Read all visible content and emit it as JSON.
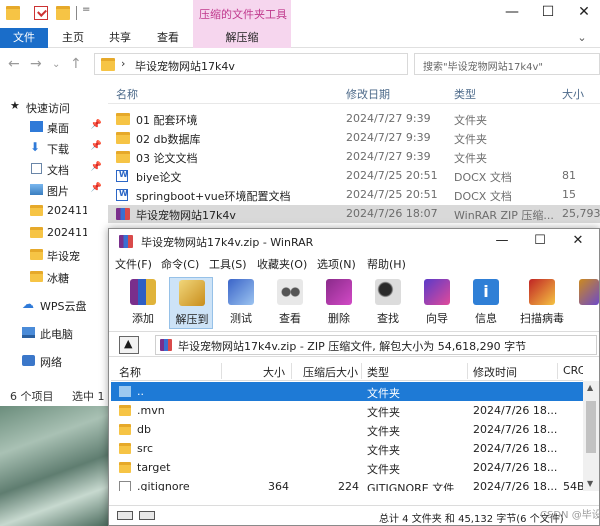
{
  "explorer": {
    "quick_access_suffix": "=",
    "context_tab_header": "压缩的文件夹工具",
    "ribbon_tabs": [
      "文件",
      "主页",
      "共享",
      "查看",
      "解压缩"
    ],
    "address": "毕设宠物网站17k4v",
    "search_placeholder": "搜索\"毕设宠物网站17k4v\"",
    "sidebar": {
      "items": [
        {
          "label": "快速访问",
          "icon": "star-icon",
          "pinned": false
        },
        {
          "label": "桌面",
          "icon": "desktop-icon",
          "pinned": true
        },
        {
          "label": "下载",
          "icon": "download-icon",
          "pinned": true
        },
        {
          "label": "文档",
          "icon": "document-icon",
          "pinned": true
        },
        {
          "label": "图片",
          "icon": "pictures-icon",
          "pinned": true
        },
        {
          "label": "202411",
          "icon": "folder-icon",
          "pinned": false
        },
        {
          "label": "202411",
          "icon": "folder-icon",
          "pinned": false
        },
        {
          "label": "毕设宠",
          "icon": "folder-icon",
          "pinned": false
        },
        {
          "label": "冰糖",
          "icon": "folder-icon",
          "pinned": false
        },
        {
          "label": "WPS云盘",
          "icon": "cloud-icon",
          "pinned": false
        },
        {
          "label": "此电脑",
          "icon": "computer-icon",
          "pinned": false
        },
        {
          "label": "网络",
          "icon": "network-icon",
          "pinned": false
        }
      ]
    },
    "status": {
      "count": "6 个项目",
      "selected": "选中 1"
    },
    "columns": [
      "名称",
      "修改日期",
      "类型",
      "大小"
    ],
    "files": [
      {
        "name": "01 配套环境",
        "date": "2024/7/27 9:39",
        "type": "文件夹",
        "size": "",
        "icon": "folder"
      },
      {
        "name": "02 db数据库",
        "date": "2024/7/27 9:39",
        "type": "文件夹",
        "size": "",
        "icon": "folder"
      },
      {
        "name": "03 论文文档",
        "date": "2024/7/27 9:39",
        "type": "文件夹",
        "size": "",
        "icon": "folder"
      },
      {
        "name": "biye论文",
        "date": "2024/7/25 20:51",
        "type": "DOCX 文档",
        "size": "81",
        "icon": "docx"
      },
      {
        "name": "springboot+vue环境配置文档",
        "date": "2024/7/25 20:51",
        "type": "DOCX 文档",
        "size": "15",
        "icon": "docx"
      },
      {
        "name": "毕设宠物网站17k4v",
        "date": "2024/7/26 18:07",
        "type": "WinRAR ZIP 压缩...",
        "size": "25,793",
        "icon": "rar",
        "selected": true
      }
    ]
  },
  "winrar": {
    "title": "毕设宠物网站17k4v.zip - WinRAR",
    "menu": [
      "文件(F)",
      "命令(C)",
      "工具(S)",
      "收藏夹(O)",
      "选项(N)",
      "帮助(H)"
    ],
    "toolbar": [
      {
        "label": "添加",
        "icon": "add-archive-icon"
      },
      {
        "label": "解压到",
        "icon": "extract-to-icon",
        "active": true
      },
      {
        "label": "测试",
        "icon": "test-icon"
      },
      {
        "label": "查看",
        "icon": "view-icon"
      },
      {
        "label": "删除",
        "icon": "delete-icon"
      },
      {
        "label": "查找",
        "icon": "find-icon"
      },
      {
        "label": "向导",
        "icon": "wizard-icon"
      },
      {
        "label": "信息",
        "icon": "info-icon"
      },
      {
        "label": "扫描病毒",
        "icon": "virus-scan-icon"
      },
      {
        "label": "",
        "icon": "more-icon"
      }
    ],
    "path": "毕设宠物网站17k4v.zip - ZIP 压缩文件, 解包大小为 54,618,290 字节",
    "columns": [
      "名称",
      "大小",
      "压缩后大小",
      "类型",
      "修改时间",
      "CRC"
    ],
    "rows": [
      {
        "name": "..",
        "size": "",
        "packed": "",
        "type": "文件夹",
        "modified": "",
        "crc": "",
        "selected": true
      },
      {
        "name": ".mvn",
        "size": "",
        "packed": "",
        "type": "文件夹",
        "modified": "2024/7/26 18...",
        "crc": ""
      },
      {
        "name": "db",
        "size": "",
        "packed": "",
        "type": "文件夹",
        "modified": "2024/7/26 18...",
        "crc": ""
      },
      {
        "name": "src",
        "size": "",
        "packed": "",
        "type": "文件夹",
        "modified": "2024/7/26 18...",
        "crc": ""
      },
      {
        "name": "target",
        "size": "",
        "packed": "",
        "type": "文件夹",
        "modified": "2024/7/26 18...",
        "crc": ""
      },
      {
        "name": ".gitignore",
        "size": "364",
        "packed": "224",
        "type": "GITIGNORE 文件",
        "modified": "2024/7/26 18...",
        "crc": "54B..."
      }
    ],
    "status": "总计 4 文件夹 和 45,132 字节(6 个文件)",
    "watermark": "CSDN @毕设"
  },
  "colors": {
    "accent": "#1a6dc9",
    "context_tab": "#f6d6ee",
    "context_text": "#c0398d",
    "selection": "#1e7ad6"
  }
}
